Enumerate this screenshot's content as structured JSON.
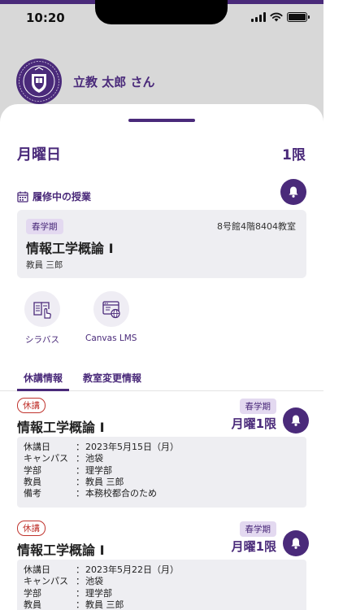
{
  "status": {
    "time": "10:20"
  },
  "user": {
    "name": "立教 太郎 さん"
  },
  "header": {
    "day": "月曜日",
    "period": "1限"
  },
  "current": {
    "section_label": "履修中の授業",
    "term": "春学期",
    "room": "8号館4階8404教室",
    "course": "情報工学概論 I",
    "teacher": "教員 三郎"
  },
  "quick_links": [
    {
      "label": "シラバス",
      "icon": "syllabus-icon"
    },
    {
      "label": "Canvas LMS",
      "icon": "canvas-lms-icon"
    }
  ],
  "tabs": [
    {
      "label": "休講情報",
      "active": true
    },
    {
      "label": "教室変更情報",
      "active": false
    }
  ],
  "notices": [
    {
      "tag": "休講",
      "course": "情報工学概論 I",
      "term": "春学期",
      "period": "月曜1限",
      "rows": [
        {
          "key": "休講日",
          "colon": "：",
          "value": "2023年5月15日（月）"
        },
        {
          "key": "キャンパス",
          "colon": "：",
          "value": "池袋"
        },
        {
          "key": "学部",
          "colon": "：",
          "value": "理学部"
        },
        {
          "key": "教員",
          "colon": "：",
          "value": "教員 三郎"
        },
        {
          "key": "備考",
          "colon": "：",
          "value": "本務校都合のため"
        }
      ]
    },
    {
      "tag": "休講",
      "course": "情報工学概論 I",
      "term": "春学期",
      "period": "月曜1限",
      "rows": [
        {
          "key": "休講日",
          "colon": "：",
          "value": "2023年5月22日（月）"
        },
        {
          "key": "キャンパス",
          "colon": "：",
          "value": "池袋"
        },
        {
          "key": "学部",
          "colon": "：",
          "value": "理学部"
        },
        {
          "key": "教員",
          "colon": "：",
          "value": "教員 三郎"
        }
      ]
    }
  ],
  "colors": {
    "accent": "#4a2a7a",
    "tag_red": "#c0342e",
    "card_bg": "#eeeef2"
  }
}
